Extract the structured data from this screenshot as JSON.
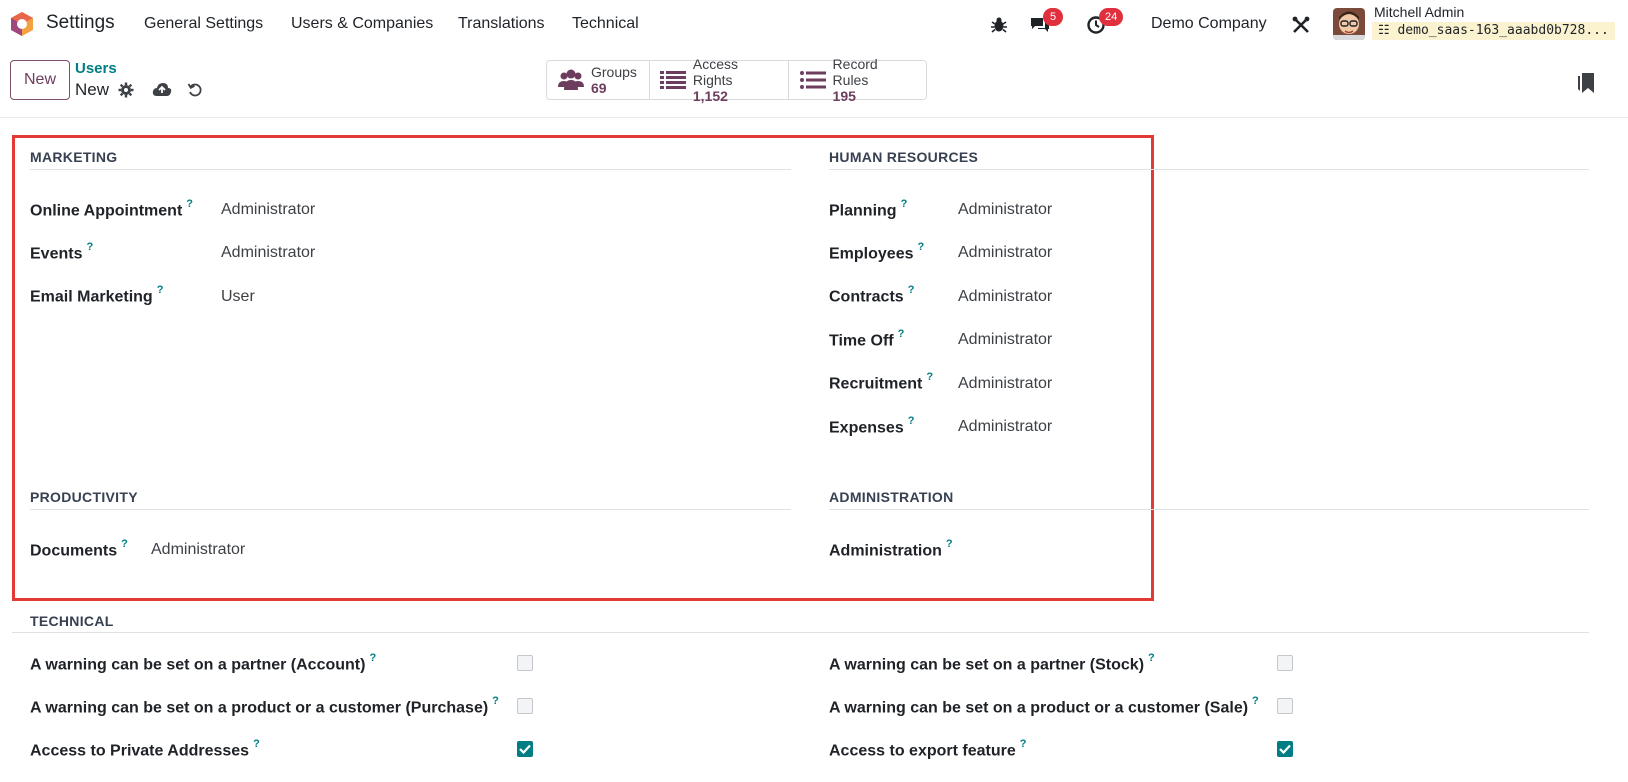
{
  "navbar": {
    "app_title": "Settings",
    "menu": [
      "General Settings",
      "Users & Companies",
      "Translations",
      "Technical"
    ],
    "messages_count": "5",
    "activities_count": "24",
    "company": "Demo Company",
    "user_name": "Mitchell Admin",
    "database": "demo_saas-163_aaabd0b728..."
  },
  "control_panel": {
    "new_label": "New",
    "breadcrumb_parent": "Users",
    "breadcrumb_current": "New",
    "smart_buttons": [
      {
        "label": "Groups",
        "value": "69",
        "icon": "users-icon"
      },
      {
        "label": "Access Rights",
        "value": "1,152",
        "icon": "list-icon"
      },
      {
        "label": "Record Rules",
        "value": "195",
        "icon": "list-icon"
      }
    ]
  },
  "sections": {
    "marketing": {
      "title": "MARKETING",
      "fields": [
        {
          "label": "Online Appointment",
          "value": "Administrator"
        },
        {
          "label": "Events",
          "value": "Administrator"
        },
        {
          "label": "Email Marketing",
          "value": "User"
        }
      ]
    },
    "human_resources": {
      "title": "HUMAN RESOURCES",
      "fields": [
        {
          "label": "Planning",
          "value": "Administrator"
        },
        {
          "label": "Employees",
          "value": "Administrator"
        },
        {
          "label": "Contracts",
          "value": "Administrator"
        },
        {
          "label": "Time Off",
          "value": "Administrator"
        },
        {
          "label": "Recruitment",
          "value": "Administrator"
        },
        {
          "label": "Expenses",
          "value": "Administrator"
        }
      ]
    },
    "productivity": {
      "title": "PRODUCTIVITY",
      "fields": [
        {
          "label": "Documents",
          "value": "Administrator"
        }
      ]
    },
    "administration": {
      "title": "ADMINISTRATION",
      "fields": [
        {
          "label": "Administration",
          "value": ""
        }
      ]
    },
    "technical": {
      "title": "TECHNICAL",
      "left": [
        {
          "label": "A warning can be set on a partner (Account)",
          "checked": false
        },
        {
          "label": "A warning can be set on a product or a customer (Purchase)",
          "checked": false
        },
        {
          "label": "Access to Private Addresses",
          "checked": true
        }
      ],
      "right": [
        {
          "label": "A warning can be set on a partner (Stock)",
          "checked": false
        },
        {
          "label": "A warning can be set on a product or a customer (Sale)",
          "checked": false
        },
        {
          "label": "Access to export feature",
          "checked": true
        }
      ]
    }
  },
  "help_marker": "?",
  "colors": {
    "brand": "#6d3d5e",
    "teal": "#017e84",
    "badge": "#e0303e",
    "highlight": "#e53935"
  }
}
